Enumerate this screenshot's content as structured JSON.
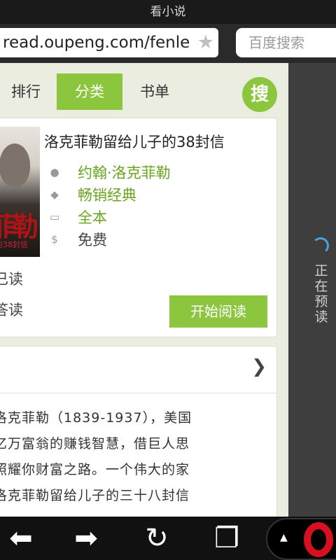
{
  "window": {
    "title": "看小说"
  },
  "toolbar": {
    "url": "read.oupeng.com/fenle",
    "search_placeholder": "百度搜索"
  },
  "tabs": [
    {
      "label": "排行"
    },
    {
      "label": "分类"
    },
    {
      "label": "书单"
    }
  ],
  "search_button": "搜",
  "book": {
    "title": "洛克菲勒留给儿子的38封信",
    "author": "约翰·洛克菲勒",
    "category": "畅销经典",
    "status": "全本",
    "price": "免费",
    "read_count": "已读",
    "read_action": "答读",
    "start_button": "开始阅读",
    "cover_text": "菲勒",
    "cover_subtext": "的38封信"
  },
  "description": {
    "lines": [
      "洛克菲勒（1839-1937），美国",
      "亿万富翁的赚钱智慧，借巨人思",
      "照耀你财富之路。一个伟大的家",
      "洛克菲勒留给儿子的三十八封信"
    ]
  },
  "side_status": "正在预读",
  "icons": {
    "star": "star-icon",
    "back": "back-arrow-icon",
    "forward": "forward-arrow-icon",
    "reload": "reload-icon",
    "tabs": "tabs-icon",
    "opera": "opera-logo"
  },
  "colors": {
    "accent": "#8cc63f",
    "link": "#6aa51f"
  }
}
